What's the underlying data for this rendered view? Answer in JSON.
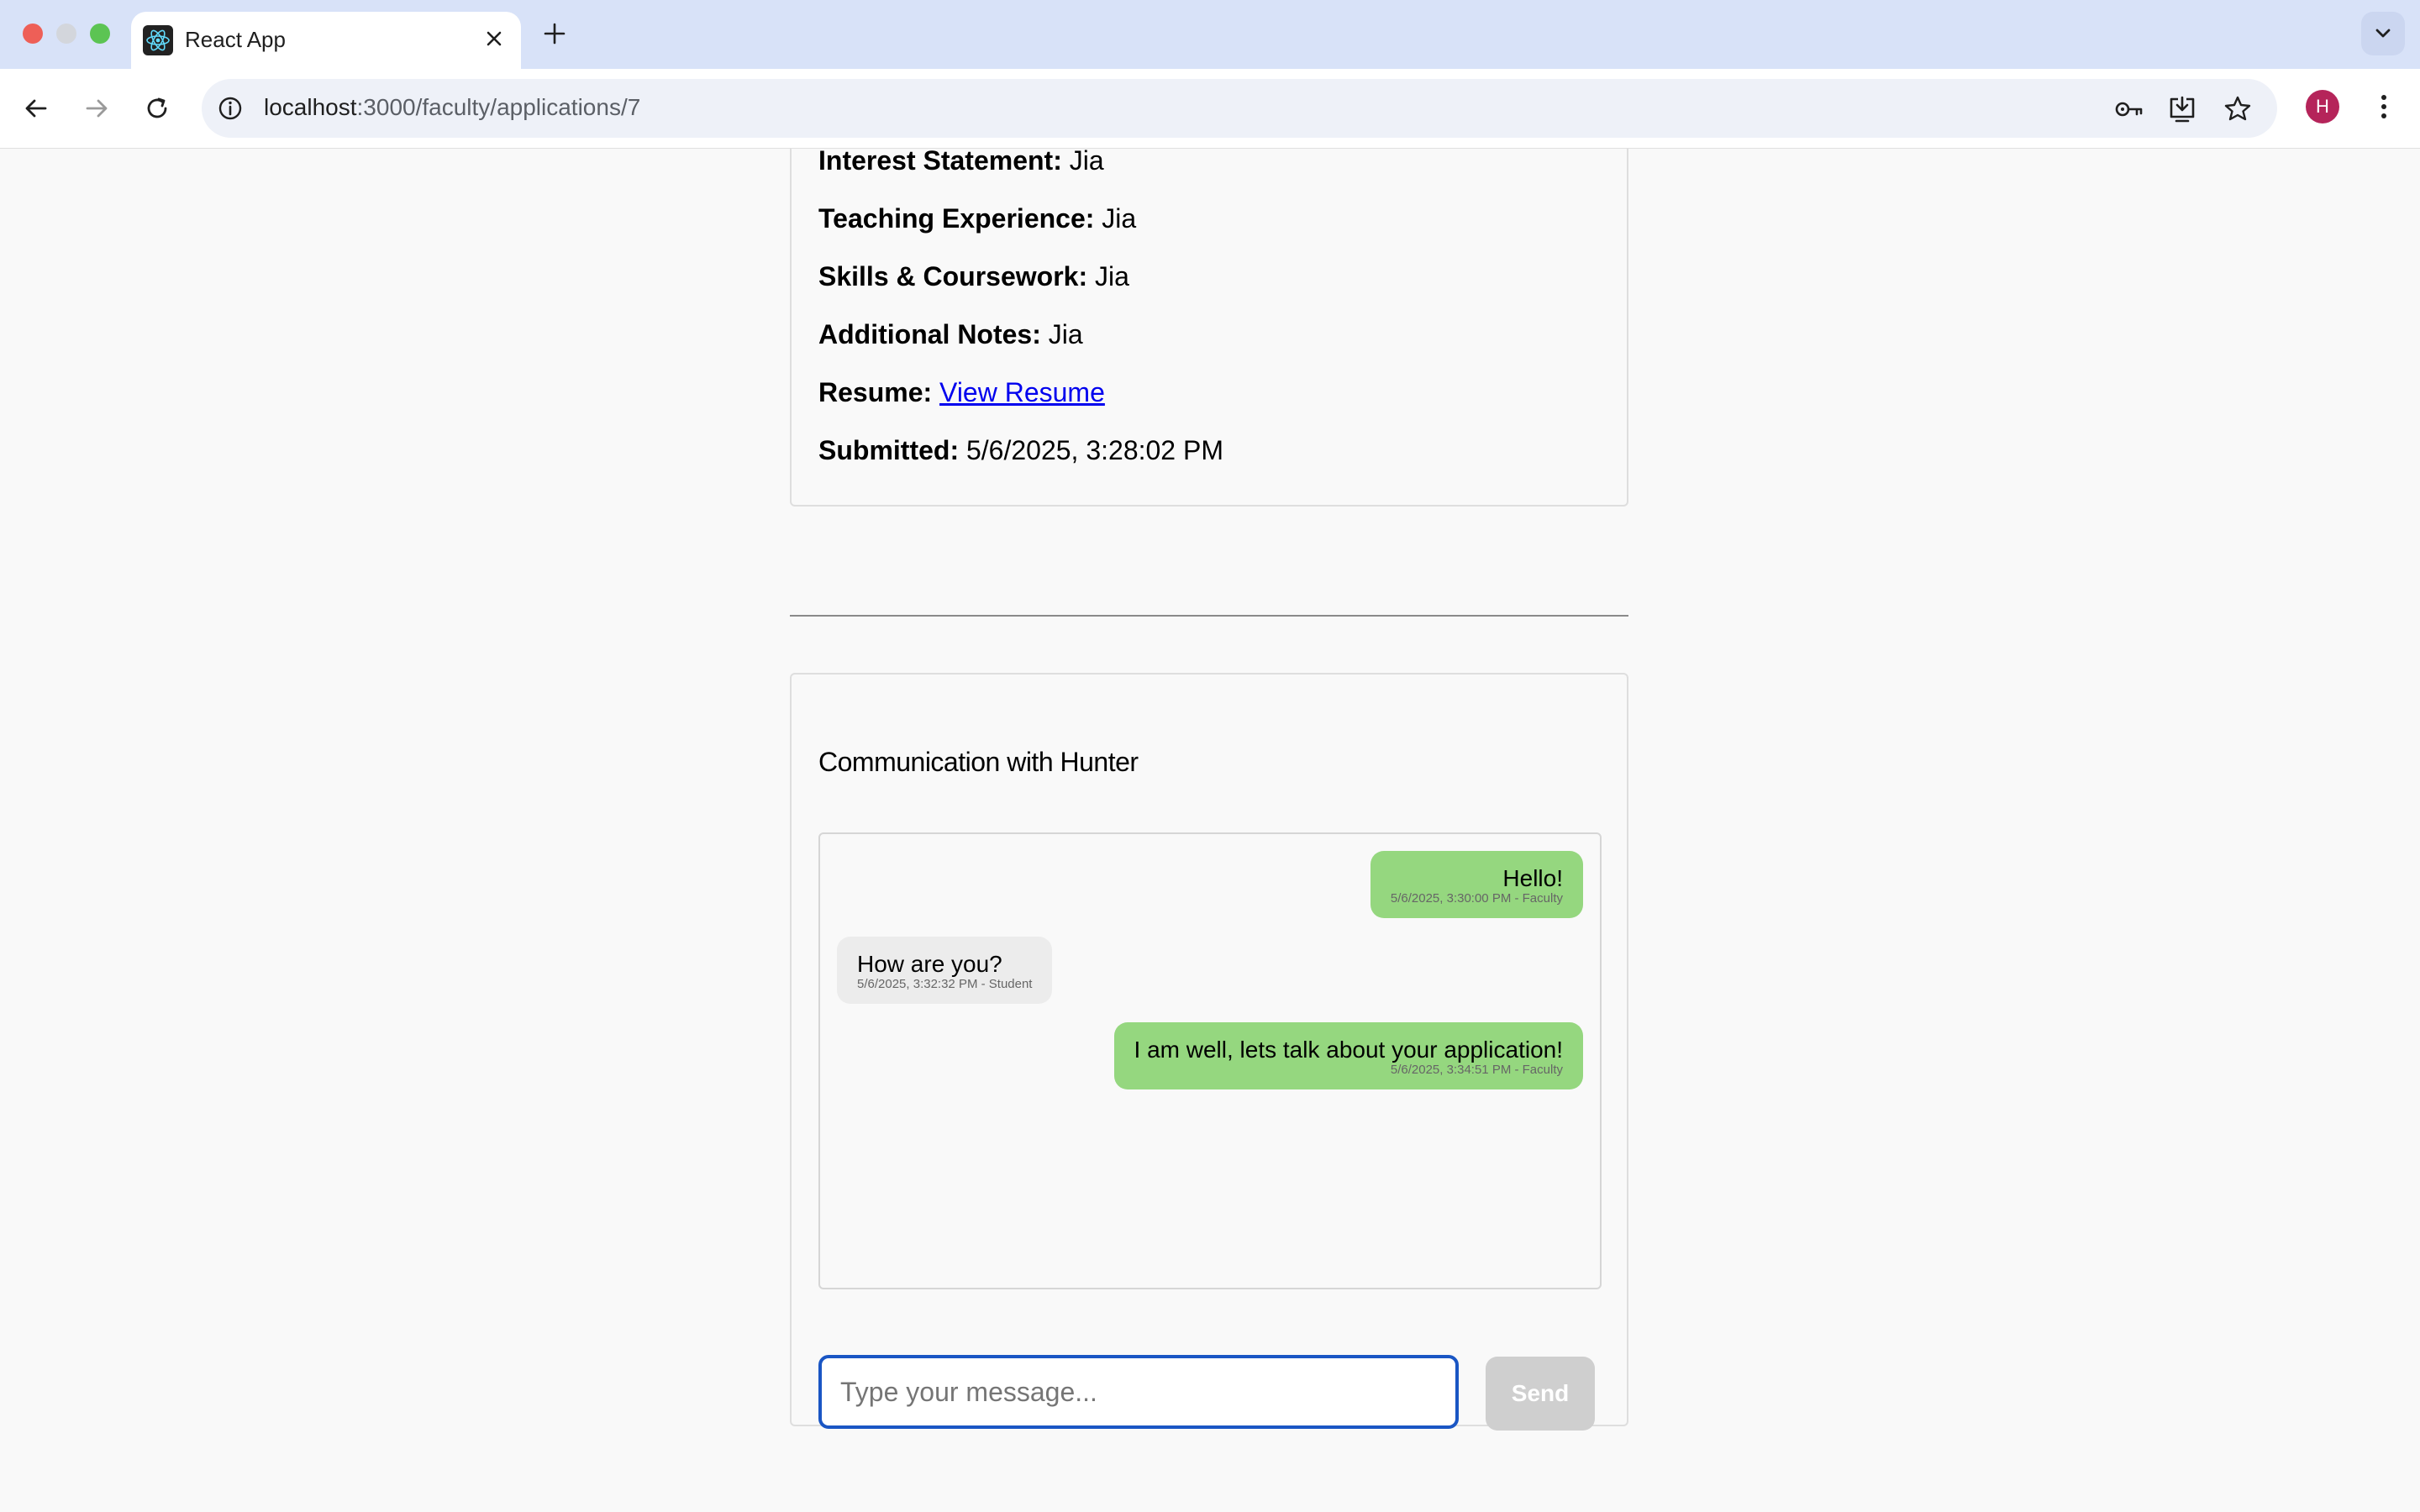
{
  "browser": {
    "tab_title": "React App",
    "url_host": "localhost",
    "url_path": ":3000/faculty/applications/7",
    "profile_initial": "H"
  },
  "application": {
    "fields": [
      {
        "label": "Interest Statement:",
        "value": "Jia"
      },
      {
        "label": "Teaching Experience:",
        "value": "Jia"
      },
      {
        "label": "Skills & Coursework:",
        "value": "Jia"
      },
      {
        "label": "Additional Notes:",
        "value": "Jia"
      }
    ],
    "resume_label": "Resume:",
    "resume_link": "View Resume",
    "submitted_label": "Submitted:",
    "submitted_value": "5/6/2025, 3:28:02 PM"
  },
  "chat": {
    "title": "Communication with Hunter",
    "messages": [
      {
        "text": "Hello!",
        "meta": "5/6/2025, 3:30:00 PM - Faculty",
        "sender": "Faculty"
      },
      {
        "text": "How are you?",
        "meta": "5/6/2025, 3:32:32 PM - Student",
        "sender": "Student"
      },
      {
        "text": "I am well, lets talk about your application!",
        "meta": "5/6/2025, 3:34:51 PM - Faculty",
        "sender": "Faculty"
      }
    ],
    "input_placeholder": "Type your message...",
    "send_label": "Send"
  },
  "colors": {
    "faculty_bubble": "#95d77f",
    "student_bubble": "#ececec",
    "input_focus": "#1a56c4",
    "send_disabled": "#cfcfcf",
    "link": "#0000ee"
  }
}
